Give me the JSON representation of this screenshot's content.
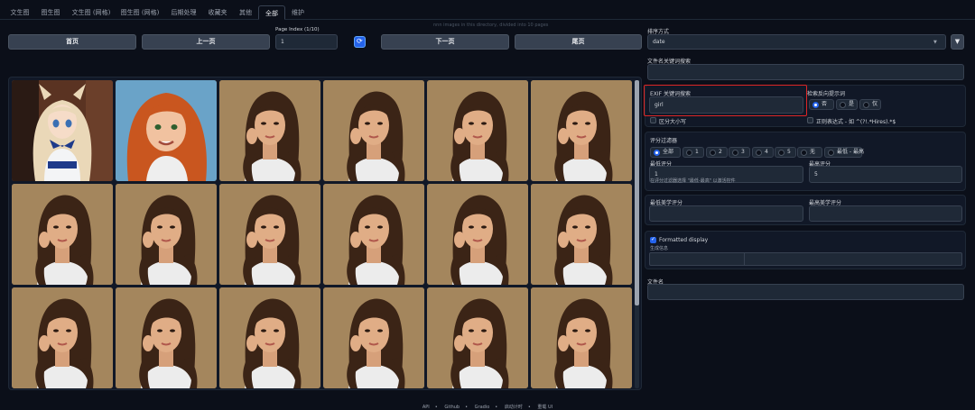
{
  "tabs": [
    "文生图",
    "图生图",
    "文生图 (网格)",
    "图生图 (网格)",
    "后期处理",
    "收藏夹",
    "其他",
    "全部",
    "维护"
  ],
  "active_tab": 7,
  "nav": {
    "info": "nnn images in this directory, divided into 10 pages",
    "first": "首页",
    "prev": "上一页",
    "page_index_label": "Page Index (1/10)",
    "page_index_value": "1",
    "next": "下一页",
    "last": "尾页"
  },
  "right": {
    "sort_label": "排序方式",
    "sort_value": "date",
    "filename_search_label": "文件名关键词搜索",
    "exif_label": "EXIF 关键词搜索",
    "exif_value": "girl",
    "negative_label": "检索反向提示词",
    "negative_options": [
      "否",
      "是",
      "仅"
    ],
    "case_label": "区分大小写",
    "regex_label": "正则表达式 - 如 ^(?!.*Hires).*$",
    "score_filter_label": "评分过滤器",
    "score_options": [
      "全部",
      "1",
      "2",
      "3",
      "4",
      "5",
      "无",
      "最低 - 最高"
    ],
    "min_score_label": "最低评分",
    "min_score_value": "1",
    "max_score_label": "最高评分",
    "max_score_value": "5",
    "score_hint": "在评分过滤器选择 \"最低-最高\" 以激活控件",
    "min_aes_label": "最低美学评分",
    "max_aes_label": "最高美学评分",
    "formatted_label": "Formatted display",
    "gen_info_label": "生成信息",
    "filename_label": "文件名"
  },
  "footer": [
    "API",
    "Github",
    "Gradio",
    "启动计时",
    "重载 UI"
  ],
  "colors": {
    "accent": "#2563eb",
    "highlight_border": "#dc2626"
  }
}
